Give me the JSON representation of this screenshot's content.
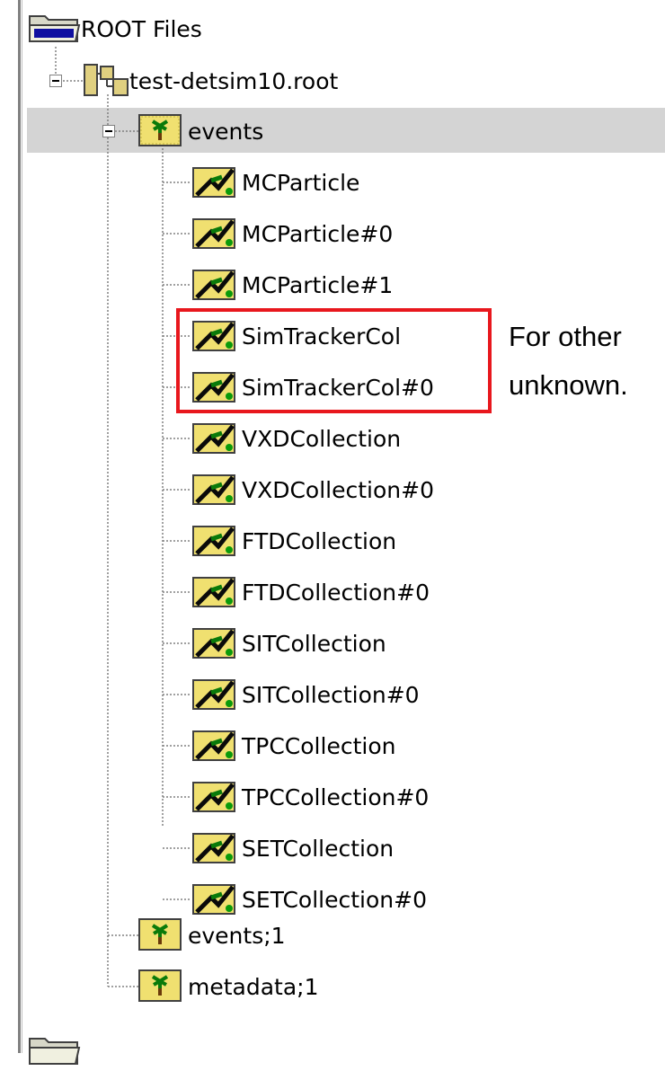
{
  "tree": {
    "root": {
      "label": "ROOT Files",
      "icon": "folder-icon"
    },
    "file": {
      "label": "test-detsim10.root",
      "icon": "root-file-icon"
    },
    "tree_node": {
      "label": "events",
      "icon": "tree-icon"
    },
    "branches": [
      {
        "label": "MCParticle"
      },
      {
        "label": "MCParticle#0"
      },
      {
        "label": "MCParticle#1"
      },
      {
        "label": "SimTrackerCol"
      },
      {
        "label": "SimTrackerCol#0"
      },
      {
        "label": "VXDCollection"
      },
      {
        "label": "VXDCollection#0"
      },
      {
        "label": "FTDCollection"
      },
      {
        "label": "FTDCollection#0"
      },
      {
        "label": "SITCollection"
      },
      {
        "label": "SITCollection#0"
      },
      {
        "label": "TPCCollection"
      },
      {
        "label": "TPCCollection#0"
      },
      {
        "label": "SETCollection"
      },
      {
        "label": "SETCollection#0"
      }
    ],
    "other_keys": [
      {
        "label": "events;1",
        "icon": "tree-icon"
      },
      {
        "label": "metadata;1",
        "icon": "tree-icon"
      }
    ],
    "bottom_partial": {
      "label": "",
      "icon": "folder-icon"
    }
  },
  "annotation": {
    "line1": "For other",
    "line2": "unknown."
  },
  "colors": {
    "highlight_border": "#e8171d",
    "selection_background": "#d4d4d4"
  }
}
